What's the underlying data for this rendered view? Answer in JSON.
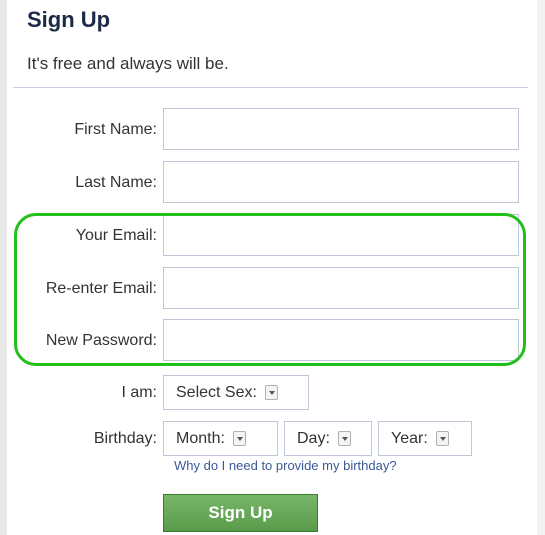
{
  "header": {
    "title": "Sign Up",
    "subtitle": "It's free and always will be."
  },
  "form": {
    "first_name_label": "First Name:",
    "first_name_value": "",
    "last_name_label": "Last Name:",
    "last_name_value": "",
    "email_label": "Your Email:",
    "email_value": "",
    "reenter_email_label": "Re-enter Email:",
    "reenter_email_value": "",
    "password_label": "New Password:",
    "password_value": "",
    "sex_label": "I am:",
    "sex_select_value": "Select Sex:",
    "birthday_label": "Birthday:",
    "birthday_month_value": "Month:",
    "birthday_day_value": "Day:",
    "birthday_year_value": "Year:",
    "birthday_help_link": "Why do I need to provide my birthday?",
    "submit_label": "Sign Up"
  },
  "colors": {
    "title": "#1c2a47",
    "highlight": "#22c11a",
    "button": "#5a9b4b",
    "link": "#3b5998"
  },
  "icons": {
    "select_arrow": "chevron-down-icon"
  }
}
